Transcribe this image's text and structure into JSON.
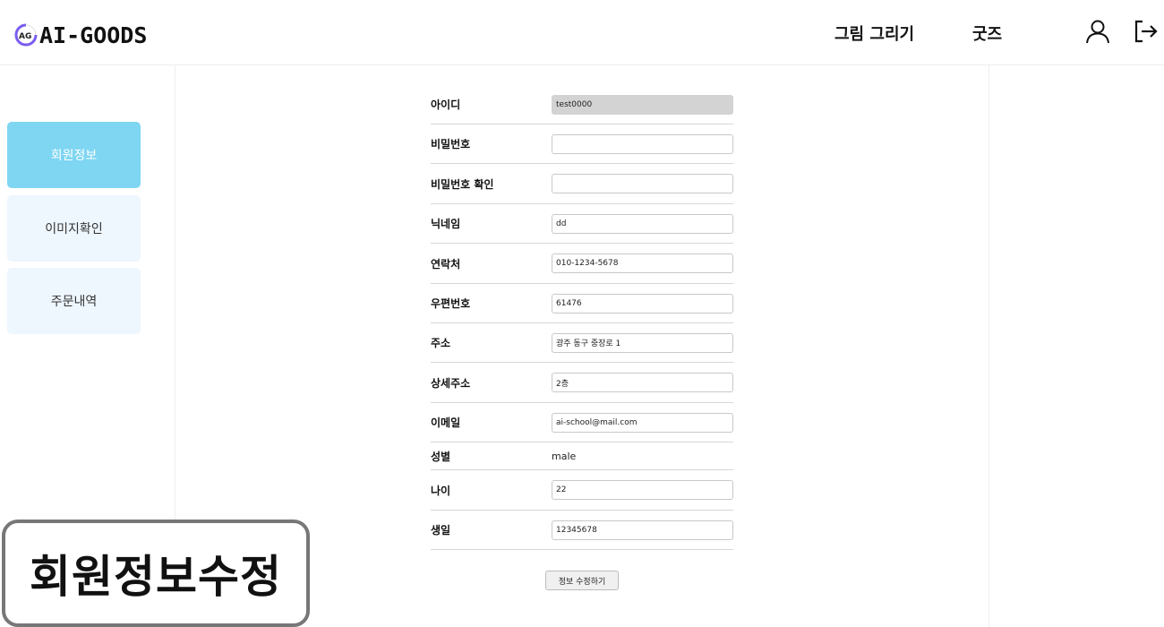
{
  "header": {
    "logo_mark": "AG",
    "logo_text": "AI-GOODS",
    "nav": [
      {
        "label": "그림 그리기"
      },
      {
        "label": "굿즈"
      }
    ],
    "icons": [
      "user-icon",
      "logout-icon"
    ]
  },
  "sidebar": {
    "items": [
      {
        "label": "회원정보",
        "active": true
      },
      {
        "label": "이미지확인",
        "active": false
      },
      {
        "label": "주문내역",
        "active": false
      }
    ]
  },
  "form": {
    "rows": [
      {
        "label": "아이디",
        "value": "test0000",
        "type": "readonly"
      },
      {
        "label": "비밀번호",
        "value": "",
        "type": "input"
      },
      {
        "label": "비밀번호 확인",
        "value": "",
        "type": "input"
      },
      {
        "label": "닉네임",
        "value": "dd",
        "type": "input"
      },
      {
        "label": "연락처",
        "value": "010-1234-5678",
        "type": "input"
      },
      {
        "label": "우편번호",
        "value": "61476",
        "type": "input"
      },
      {
        "label": "주소",
        "value": "광주 동구 중장로 1",
        "type": "input"
      },
      {
        "label": "상세주소",
        "value": "2층",
        "type": "input"
      },
      {
        "label": "이메일",
        "value": "ai-school@mail.com",
        "type": "input"
      },
      {
        "label": "성별",
        "value": "male",
        "type": "text"
      },
      {
        "label": "나이",
        "value": "22",
        "type": "input"
      },
      {
        "label": "생일",
        "value": "12345678",
        "type": "input"
      }
    ],
    "submit_label": "정보 수정하기"
  },
  "caption": {
    "text": "회원정보수정"
  },
  "colors": {
    "active_side": "#7ed6f2",
    "inactive_side": "#eef6fe",
    "readonly_field": "#d3d3d3"
  }
}
